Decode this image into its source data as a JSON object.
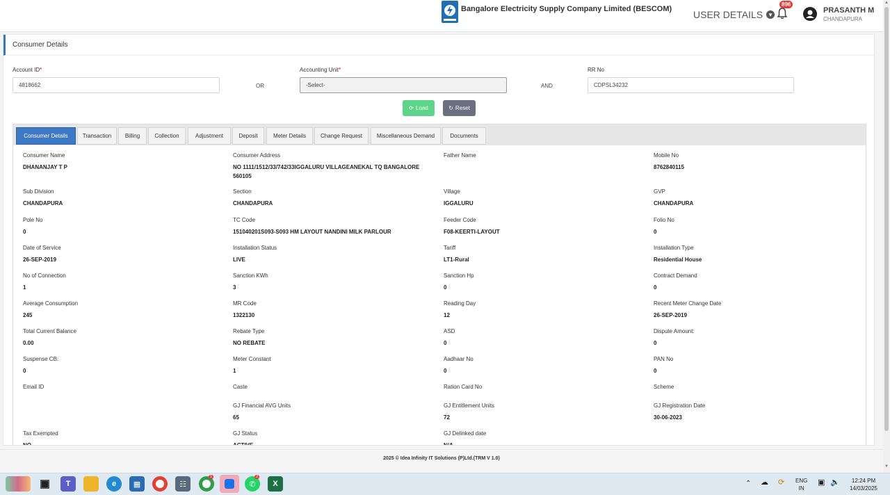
{
  "header": {
    "company": "Bangalore Electricity Supply Company Limited (BESCOM)",
    "user_details": "USER DETAILS",
    "notification_count": "896",
    "user_name": "PRASANTH M",
    "user_location": "CHANDAPURA"
  },
  "page_title": "Consumer Details",
  "search": {
    "account_label": "Account ID",
    "account_value": "4818662",
    "or_label": "OR",
    "accounting_unit_label": "Accounting Unit",
    "accounting_unit_value": "-Select-",
    "and_label": "AND",
    "rr_label": "RR No",
    "rr_value": "CDPSL34232",
    "load_label": "Load",
    "reset_label": "Reset"
  },
  "tabs": [
    {
      "label": "Consumer Details"
    },
    {
      "label": "Transaction"
    },
    {
      "label": "Billing"
    },
    {
      "label": "Collection"
    },
    {
      "label": "Adjustment"
    },
    {
      "label": "Deposit"
    },
    {
      "label": "Meter Details"
    },
    {
      "label": "Change Request"
    },
    {
      "label": "Miscellaneous Demand"
    },
    {
      "label": "Documents"
    }
  ],
  "fields": [
    {
      "label": "Consumer Name",
      "value": "DHANANJAY T P"
    },
    {
      "label": "Consumer Address",
      "value": "NO 1111/1512/33/742/33IGGALURU VILLAGEANEKAL TQ BANGALORE 560105"
    },
    {
      "label": "Father Name",
      "value": ""
    },
    {
      "label": "Mobile No",
      "value": "8762840115"
    },
    {
      "label": "Sub Division",
      "value": "CHANDAPURA"
    },
    {
      "label": "Section",
      "value": "CHANDAPURA"
    },
    {
      "label": "Village",
      "value": "IGGALURU"
    },
    {
      "label": "GVP",
      "value": "CHANDAPURA"
    },
    {
      "label": "Pole No",
      "value": "0"
    },
    {
      "label": "TC Code",
      "value": "151040201S093-S093 HM LAYOUT NANDINI MILK PARLOUR"
    },
    {
      "label": "Feeder Code",
      "value": "F08-KEERTI-LAYOUT"
    },
    {
      "label": "Folio No",
      "value": "0"
    },
    {
      "label": "Date of Service",
      "value": "26-SEP-2019"
    },
    {
      "label": "Installation Status",
      "value": "LIVE"
    },
    {
      "label": "Tariff",
      "value": "LT1-Rural"
    },
    {
      "label": "Installation Type",
      "value": "Residential House"
    },
    {
      "label": "No of Connection",
      "value": "1"
    },
    {
      "label": "Sanction KWh",
      "value": "3"
    },
    {
      "label": "Sanction Hp",
      "value": "0"
    },
    {
      "label": "Contract Demand",
      "value": "0"
    },
    {
      "label": "Average Consumption",
      "value": "245"
    },
    {
      "label": "MR Code",
      "value": "1322130"
    },
    {
      "label": "Reading Day",
      "value": "12"
    },
    {
      "label": "Recent Meter Change Date",
      "value": "26-SEP-2019"
    },
    {
      "label": "Total Current Balance",
      "value": "0.00"
    },
    {
      "label": "Rebate Type",
      "value": "NO REBATE"
    },
    {
      "label": "ASD",
      "value": "0"
    },
    {
      "label": "Dispute Amount:",
      "value": "0"
    },
    {
      "label": "Suspense CB:",
      "value": "0"
    },
    {
      "label": "Meter Constant",
      "value": "1"
    },
    {
      "label": "Aadhaar No",
      "value": "0"
    },
    {
      "label": "PAN No",
      "value": "0"
    },
    {
      "label": "Email ID",
      "value": ""
    },
    {
      "label": "Caste",
      "value": ""
    },
    {
      "label": "Ration Card No",
      "value": ""
    },
    {
      "label": "Scheme",
      "value": ""
    },
    {
      "label": "",
      "value": ""
    },
    {
      "label": "GJ Financial AVG Units",
      "value": "65"
    },
    {
      "label": "GJ Entitlement Units",
      "value": "72"
    },
    {
      "label": "GJ Registration Date",
      "value": "30-06-2023"
    },
    {
      "label": "Tax Exempted",
      "value": "NO"
    },
    {
      "label": "GJ Status",
      "value": "ACTIVE"
    },
    {
      "label": "GJ Delinked date",
      "value": "N/A"
    },
    {
      "label": "",
      "value": ""
    }
  ],
  "footer": "2025 © Idea Infinity IT Solutions (P)Ltd.(TRM V 1.0)",
  "taskbar": {
    "chrome_badge": "1",
    "whatsapp_badge": "2",
    "lang_top": "ENG",
    "lang_bottom": "IN",
    "time": "12:24 PM",
    "date": "14/03/2025"
  }
}
